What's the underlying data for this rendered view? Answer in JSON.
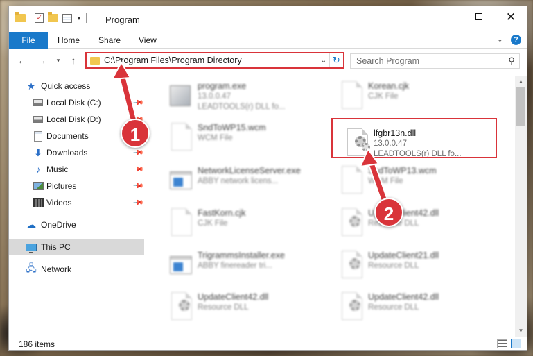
{
  "window": {
    "title": "Program"
  },
  "ribbon": {
    "tabs": [
      "File",
      "Home",
      "Share",
      "View"
    ]
  },
  "navigation": {
    "address": "C:\\Program Files\\Program Directory",
    "search_placeholder": "Search Program"
  },
  "sidebar": {
    "items": [
      {
        "label": "Quick access",
        "icon": "star-icon"
      },
      {
        "label": "Local Disk (C:)",
        "icon": "drive-icon",
        "pinned": true
      },
      {
        "label": "Local Disk (D:)",
        "icon": "drive-icon",
        "pinned": true
      },
      {
        "label": "Documents",
        "icon": "documents-icon",
        "pinned": true
      },
      {
        "label": "Downloads",
        "icon": "download-icon",
        "pinned": true
      },
      {
        "label": "Music",
        "icon": "music-icon",
        "pinned": true
      },
      {
        "label": "Pictures",
        "icon": "pictures-icon",
        "pinned": true
      },
      {
        "label": "Videos",
        "icon": "videos-icon",
        "pinned": true
      },
      {
        "label": "OneDrive",
        "icon": "cloud-icon"
      },
      {
        "label": "This PC",
        "icon": "computer-icon",
        "selected": true
      },
      {
        "label": "Network",
        "icon": "network-icon"
      }
    ]
  },
  "files": [
    {
      "name": "program.exe",
      "line1": "13.0.0.47",
      "line2": "LEADTOOLS(r) DLL fo...",
      "icon": "exe-icon"
    },
    {
      "name": "Korean.cjk",
      "line1": "CJK File",
      "line2": "",
      "icon": "file-icon"
    },
    {
      "name": "SndToWP15.wcm",
      "line1": "WCM File",
      "line2": "",
      "icon": "file-icon"
    },
    {
      "name": "lfgbr13n.dll",
      "line1": "13.0.0.47",
      "line2": "LEADTOOLS(r) DLL fo...",
      "icon": "dll-gear-icon",
      "highlighted": true
    },
    {
      "name": "NetworkLicenseServer.exe",
      "line1": "ABBY network licens...",
      "line2": "",
      "icon": "application-icon"
    },
    {
      "name": "SndToWP13.wcm",
      "line1": "WCM File",
      "line2": "",
      "icon": "file-icon"
    },
    {
      "name": "FastKorn.cjk",
      "line1": "CJK File",
      "line2": "",
      "icon": "file-icon"
    },
    {
      "name": "UpdateClient42.dll",
      "line1": "Resource DLL",
      "line2": "",
      "icon": "dll-gear-icon"
    },
    {
      "name": "TrigrammsInstaller.exe",
      "line1": "ABBY finereader tri...",
      "line2": "",
      "icon": "application-icon"
    },
    {
      "name": "UpdateClient21.dll",
      "line1": "Resource DLL",
      "line2": "",
      "icon": "dll-gear-icon"
    },
    {
      "name": "UpdateClient42.dll",
      "line1": "Resource DLL",
      "line2": "",
      "icon": "dll-gear-icon"
    },
    {
      "name": "UpdateClient42.dll",
      "line1": "Resource DLL",
      "line2": "",
      "icon": "dll-gear-icon"
    }
  ],
  "status": {
    "item_count": "186 items"
  },
  "callouts": [
    "1",
    "2"
  ],
  "colors": {
    "accent": "#1979ca",
    "annotation_red": "#d9343a"
  }
}
